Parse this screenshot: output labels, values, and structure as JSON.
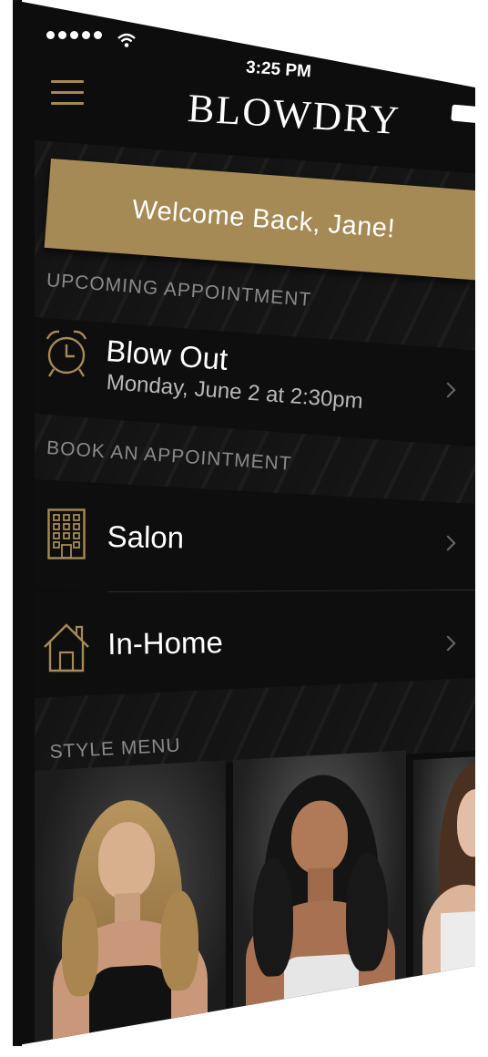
{
  "status_bar": {
    "time": "3:25 PM",
    "signal_dots": 5,
    "wifi_icon": "wifi-icon",
    "battery_icon": "battery-icon"
  },
  "header": {
    "menu_icon": "hamburger-menu-icon",
    "logo": "BLOWDRY"
  },
  "welcome": {
    "text": "Welcome Back, Jane!"
  },
  "upcoming": {
    "section_label": "UPCOMING APPOINTMENT",
    "icon": "alarm-clock-icon",
    "service": "Blow Out",
    "datetime": "Monday, June 2 at 2:30pm"
  },
  "book": {
    "section_label": "BOOK AN APPOINTMENT",
    "items": [
      {
        "icon": "building-icon",
        "label": "Salon"
      },
      {
        "icon": "house-icon",
        "label": "In-Home"
      }
    ]
  },
  "style_menu": {
    "section_label": "STYLE MENU",
    "photos": [
      "blonde-wavy-style-photo",
      "dark-curly-style-photo",
      "brunette-straight-style-photo"
    ]
  },
  "colors": {
    "accent_gold": "#a58a55",
    "background": "#0d0d0d",
    "text_primary": "#ffffff",
    "text_secondary": "#8a8a8a"
  }
}
